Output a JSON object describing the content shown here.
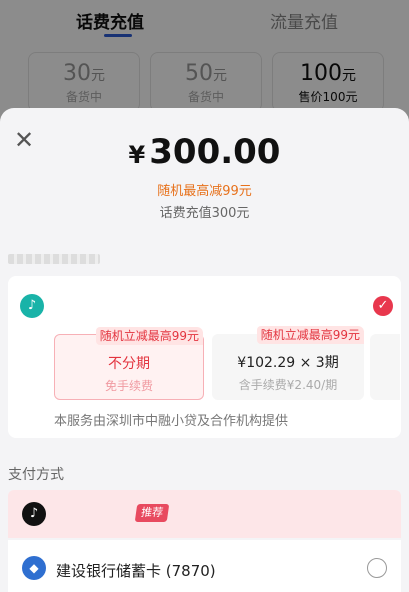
{
  "background": {
    "tabs": [
      {
        "label": "话费充值",
        "active": true
      },
      {
        "label": "流量充值",
        "active": false
      }
    ],
    "cards": [
      {
        "amount": "30",
        "unit": "元",
        "status": "备货中"
      },
      {
        "amount": "50",
        "unit": "元",
        "status": "备货中"
      },
      {
        "amount": "100",
        "unit": "元",
        "status": "售价100元"
      }
    ]
  },
  "sheet": {
    "close_icon": "close-icon",
    "currency": "¥",
    "price": "300.00",
    "promo": "随机最高减99元",
    "description": "话费充值300元",
    "credit": {
      "app_icon": "douyin-icon",
      "selected": true,
      "plans": [
        {
          "tag": "随机立减最高99元",
          "main": "不分期",
          "fee": "免手续费",
          "selected": true
        },
        {
          "tag": "随机立减最高99元",
          "main": "¥102.29 × 3期",
          "fee": "含手续费¥2.40/期",
          "selected": false
        }
      ],
      "service_note": "本服务由深圳市中融小贷及合作机构提供"
    },
    "payment": {
      "title": "支付方式",
      "recommended": {
        "icon": "douyin-icon",
        "badge": "推荐"
      },
      "bank": {
        "icon": "ccb-icon",
        "label": "建设银行储蓄卡 (7870)",
        "selected": false
      }
    }
  },
  "colors": {
    "accent_red": "#e3343f",
    "promo_orange": "#e7711b",
    "tab_blue": "#2d5bd3"
  }
}
